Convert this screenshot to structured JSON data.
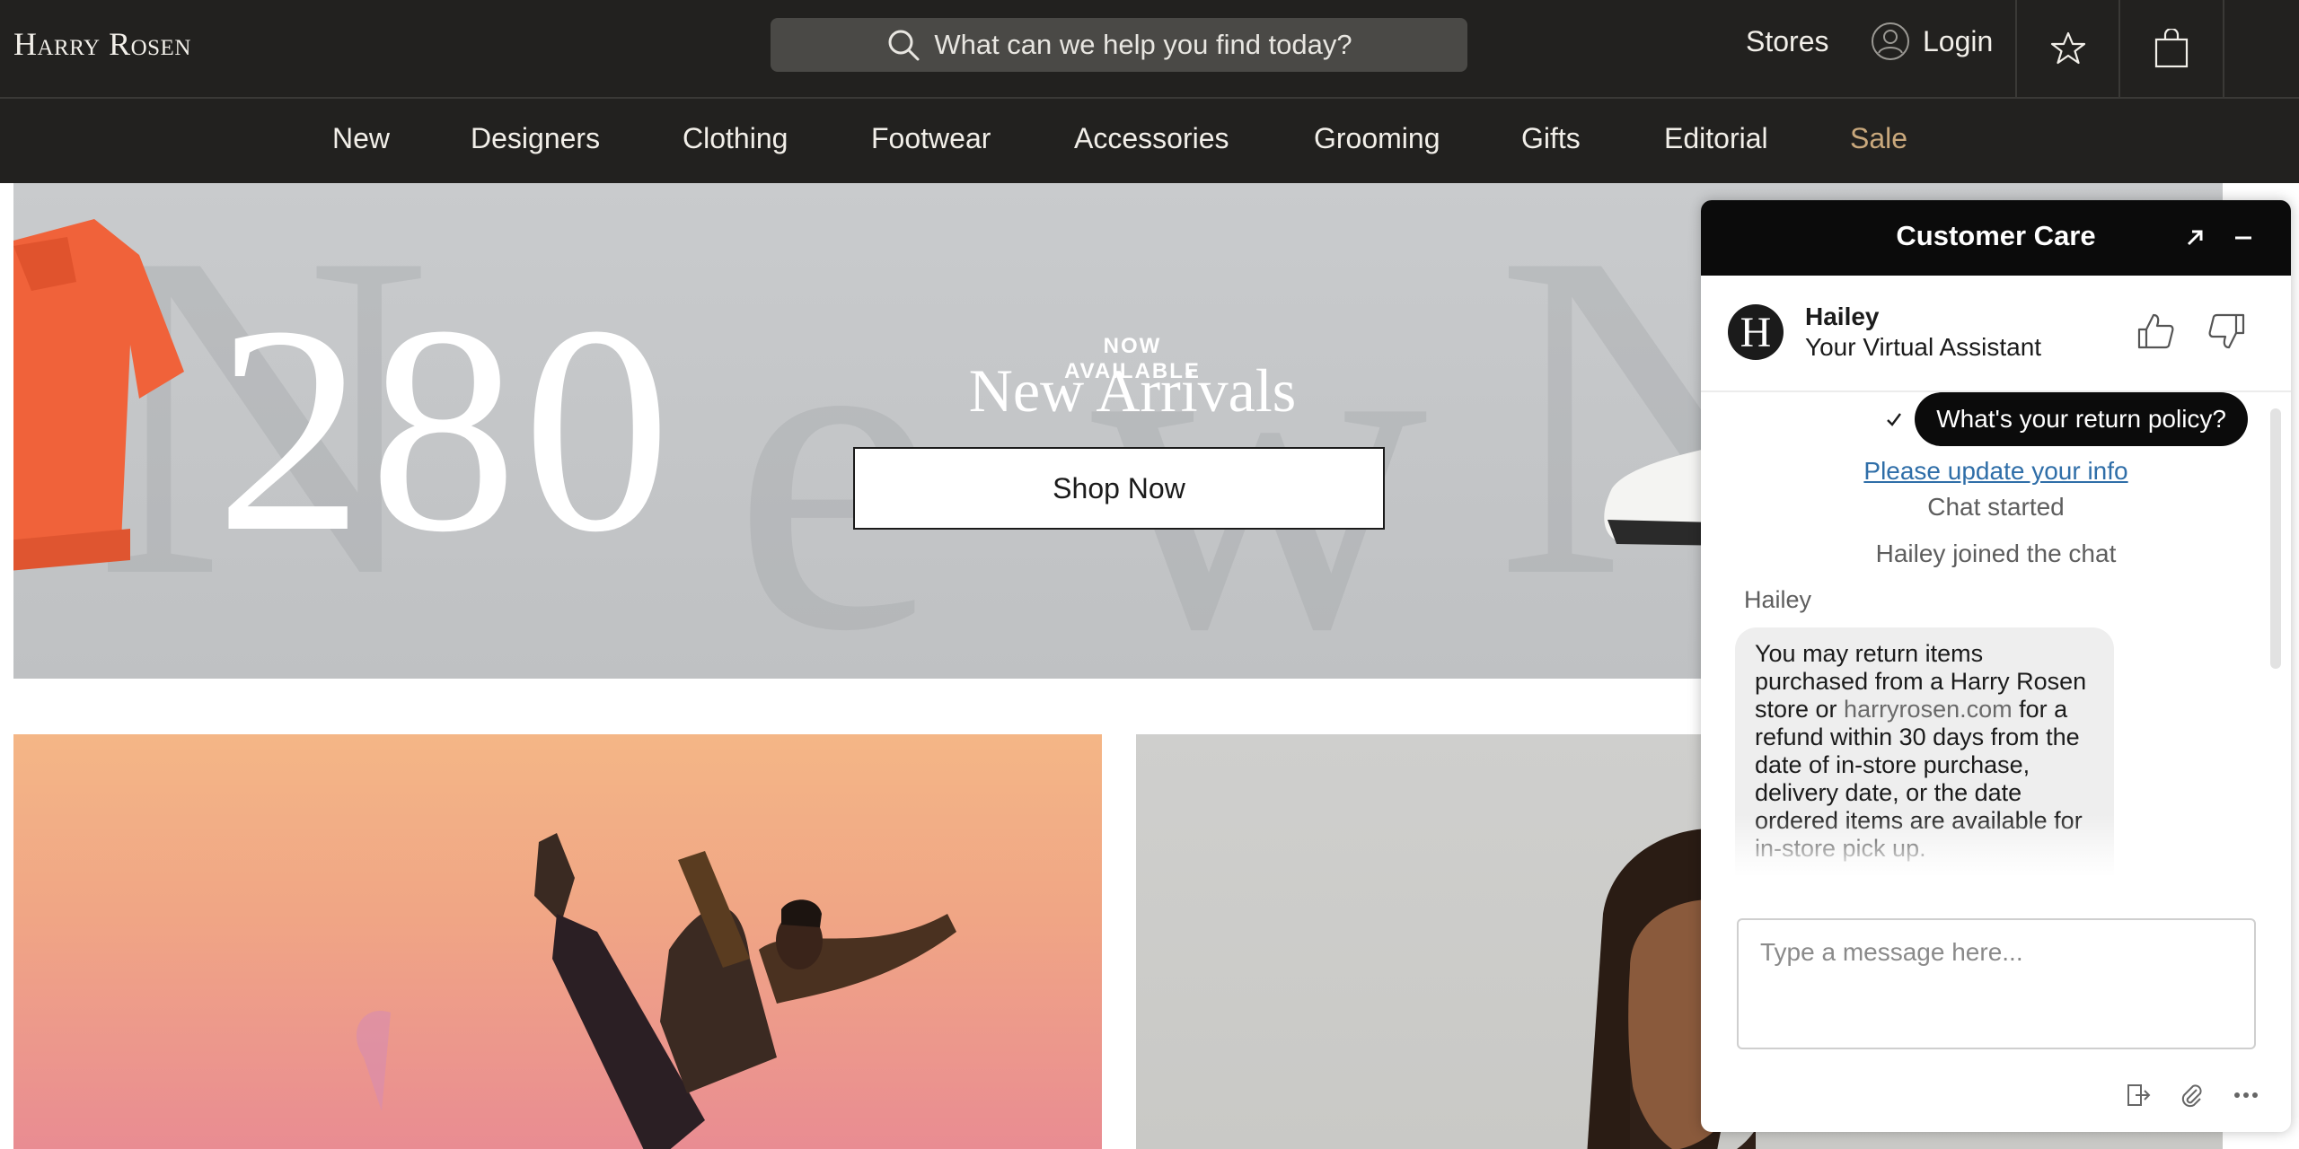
{
  "header": {
    "logo": "Harry Rosen",
    "search_placeholder": "What can we help you find today?",
    "stores": "Stores",
    "login": "Login"
  },
  "nav": {
    "items": [
      "New",
      "Designers",
      "Clothing",
      "Footwear",
      "Accessories",
      "Grooming",
      "Gifts",
      "Editorial"
    ],
    "sale": "Sale",
    "sale_color": "#c9a87c"
  },
  "hero": {
    "price": "280",
    "eyebrow": "NOW AVAILABLE",
    "headline": "New Arrivals",
    "cta": "Shop Now"
  },
  "chat": {
    "title": "Customer Care",
    "agent_initial": "H",
    "agent_name": "Hailey",
    "agent_role": "Your Virtual Assistant",
    "sent_message": "What's your return policy?",
    "update_link": "Please update your info",
    "system_1": "Chat started",
    "system_2": "Hailey joined the chat",
    "sender": "Hailey",
    "reply_part1": "You may return items purchased from a Harry Rosen store or ",
    "reply_link": "harryrosen.com",
    "reply_part2": " for a refund within 30 days from the date of in-store purchase, delivery date, or the date ordered items are available for in-store pick up.",
    "composer_placeholder": "Type a message here..."
  },
  "colors": {
    "header_bg": "#22211f",
    "accent_sale": "#c9a87c",
    "chat_header": "#0b0b0b",
    "link_blue": "#2f6ea8"
  }
}
